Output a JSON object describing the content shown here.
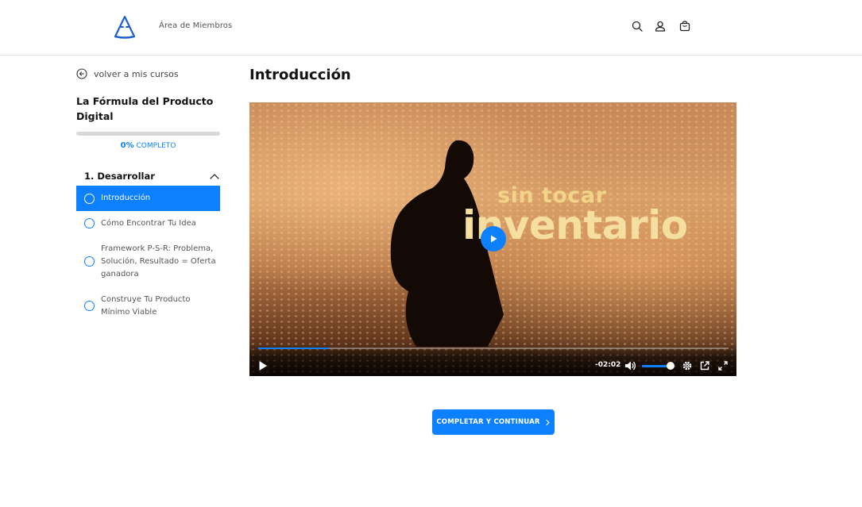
{
  "header": {
    "brand_text": "Área de Miembros",
    "icons": [
      "search-icon",
      "user-icon",
      "cart-icon"
    ]
  },
  "sidebar": {
    "back_label": "volver a mis cursos",
    "course_title": "La Fórmula del Producto Digital",
    "progress": {
      "percent_value": 0,
      "percent_label": "0%",
      "suffix": "COMPLETO"
    },
    "section": {
      "title": "1. Desarrollar",
      "expanded": true
    },
    "lessons": [
      {
        "label": "Introducción",
        "active": true
      },
      {
        "label": "Cómo Encontrar Tu Idea",
        "active": false
      },
      {
        "label": "Framework P-S-R: Problema, Solución, Resultado = Oferta ganadora",
        "active": false
      },
      {
        "label": "Construye Tu Producto Mínimo Viable",
        "active": false
      }
    ]
  },
  "main": {
    "title": "Introducción",
    "video": {
      "overlay_line1": "sin tocar",
      "overlay_line2": "inventario",
      "time_remaining": "-02:02",
      "played_fraction": 0.15,
      "volume_fraction": 0.85
    },
    "complete_button": "COMPLETAR Y CONTINUAR"
  },
  "colors": {
    "accent": "#0d80ff",
    "text": "#121212",
    "muted": "#555555"
  }
}
